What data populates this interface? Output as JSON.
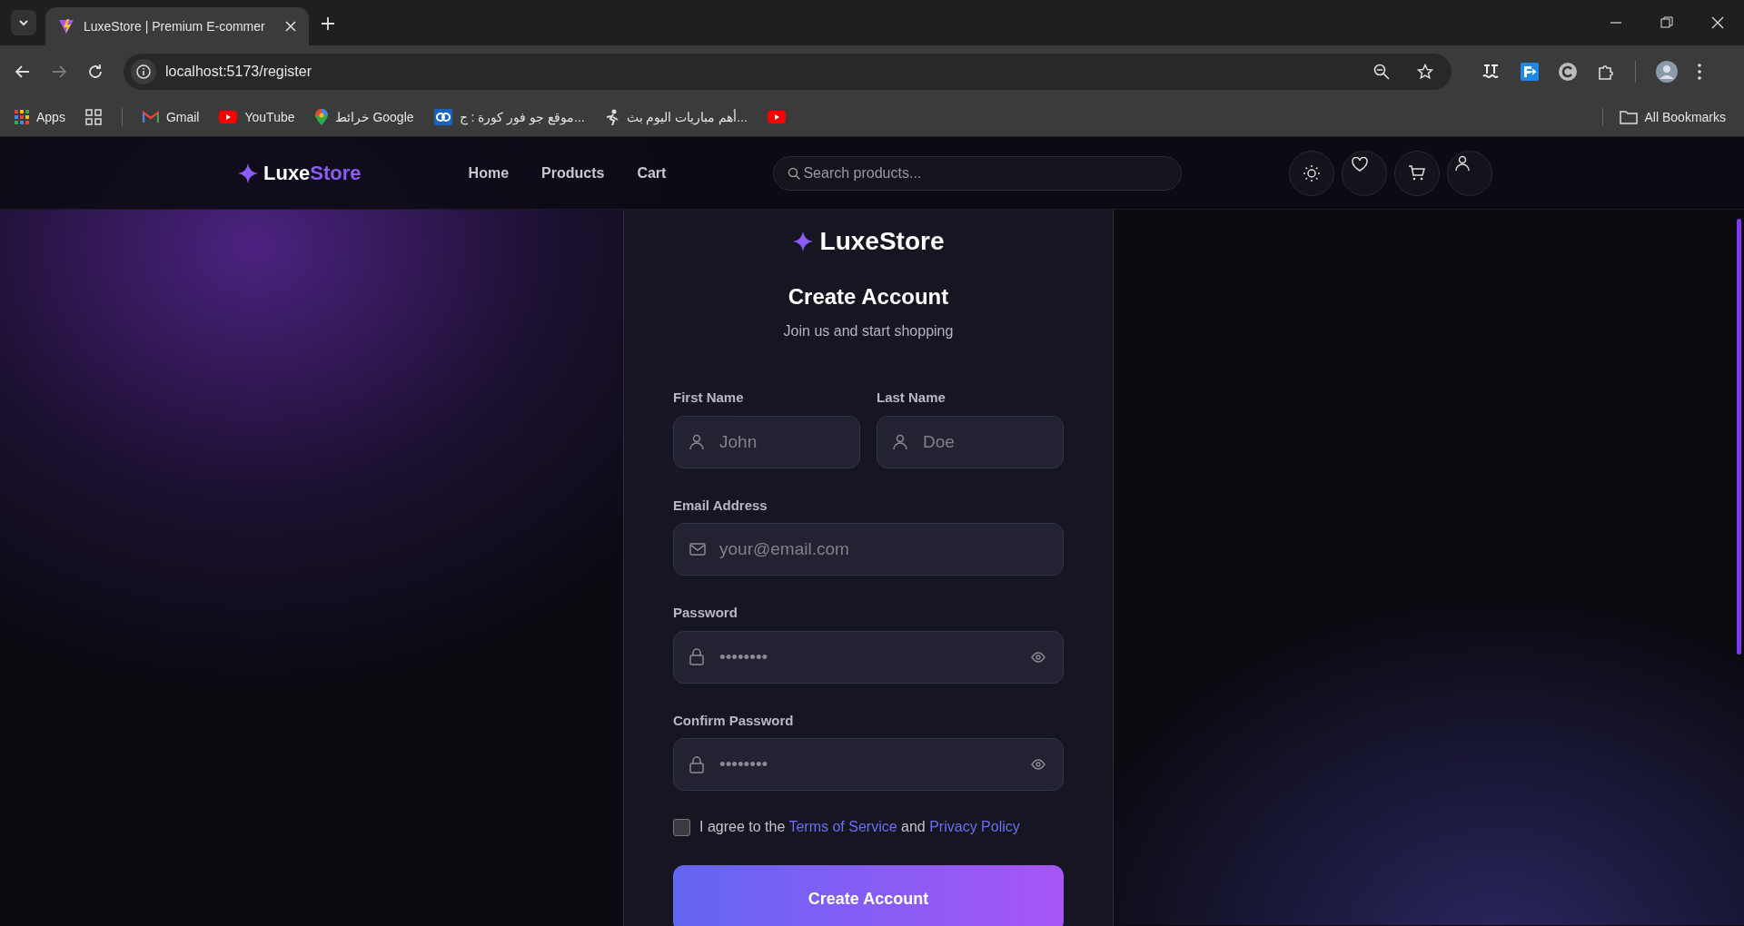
{
  "browser": {
    "tab_title": "LuxeStore | Premium E-commer",
    "address": "localhost:5173/register",
    "bookmarks": [
      {
        "kind": "apps",
        "label": "Apps"
      },
      {
        "kind": "grid"
      },
      {
        "kind": "gmail",
        "label": "Gmail"
      },
      {
        "kind": "youtube",
        "label": "YouTube"
      },
      {
        "kind": "maps",
        "label": "خرائط Google"
      },
      {
        "kind": "site",
        "label": "موقع جو فور كورة : ج..."
      },
      {
        "kind": "player",
        "label": "أهم مباريات اليوم بث..."
      },
      {
        "kind": "youtube"
      }
    ],
    "all_bookmarks": "All Bookmarks"
  },
  "header": {
    "logo_first": "Luxe",
    "logo_second": "Store",
    "nav": [
      {
        "label": "Home",
        "selected": false
      },
      {
        "label": "Products",
        "selected": false
      },
      {
        "label": "Cart",
        "selected": false
      }
    ],
    "search": {
      "placeholder": "Search products..."
    }
  },
  "form": {
    "logo": "LuxeStore",
    "title": "Create Account",
    "subtitle": "Join us and start shopping",
    "name_fields": [
      {
        "label": "First Name",
        "placeholder": "John"
      },
      {
        "label": "Last Name",
        "placeholder": "Doe"
      }
    ],
    "fields": [
      {
        "kind": "email",
        "label": "Email Address",
        "placeholder": "your@email.com"
      },
      {
        "kind": "password",
        "label": "Password",
        "value": "••••••••"
      },
      {
        "kind": "password",
        "label": "Confirm Password",
        "value": "••••••••"
      }
    ],
    "agree": {
      "checked": false,
      "text_before": "I agree to the",
      "terms_link": "Terms of Service",
      "text_middle": "and",
      "privacy_link": "Privacy Policy"
    },
    "submit": "Create Account"
  }
}
